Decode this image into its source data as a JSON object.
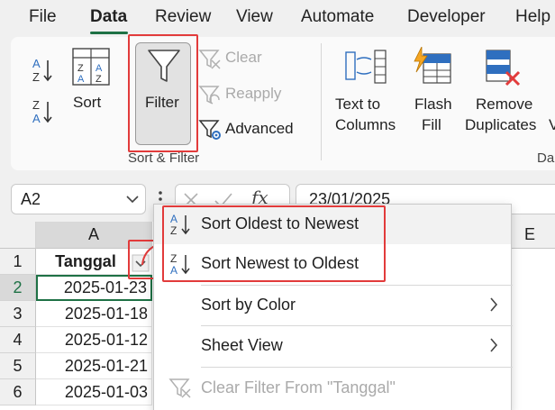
{
  "tabs": [
    "File",
    "Data",
    "Review",
    "View",
    "Automate",
    "Developer",
    "Help"
  ],
  "ribbon": {
    "sort_label": "Sort",
    "filter_label": "Filter",
    "clear_label": "Clear",
    "reapply_label": "Reapply",
    "advanced_label": "Advanced",
    "group_label": "Sort & Filter",
    "text_to_columns": [
      "Text to",
      "Columns"
    ],
    "flash_fill": [
      "Flash",
      "Fill"
    ],
    "remove_duplicates": [
      "Remove",
      "Duplicates"
    ],
    "cut_v": "V",
    "cut_group": "Da",
    "sort_az_top": "A",
    "sort_az_bottom": "Z",
    "sort_za_top": "Z",
    "sort_za_bottom": "A"
  },
  "name_box": "A2",
  "formula_value": "23/01/2025",
  "fx_label": "fx",
  "columns": [
    "A",
    "E"
  ],
  "rows": [
    {
      "num": "1",
      "value": "Tanggal"
    },
    {
      "num": "2",
      "value": "2025-01-23"
    },
    {
      "num": "3",
      "value": "2025-01-18"
    },
    {
      "num": "4",
      "value": "2025-01-12"
    },
    {
      "num": "5",
      "value": "2025-01-21"
    },
    {
      "num": "6",
      "value": "2025-01-03"
    }
  ],
  "menu": {
    "sort_oldest": "Sort Oldest to Newest",
    "sort_newest": "Sort Newest to Oldest",
    "sort_by_color": "Sort by Color",
    "sheet_view": "Sheet View",
    "clear_filter": "Clear Filter From \"Tanggal\""
  },
  "colors": {
    "accent": "#1e7145",
    "highlight": "#e23b3b",
    "icon_blue": "#2f6fbf"
  }
}
